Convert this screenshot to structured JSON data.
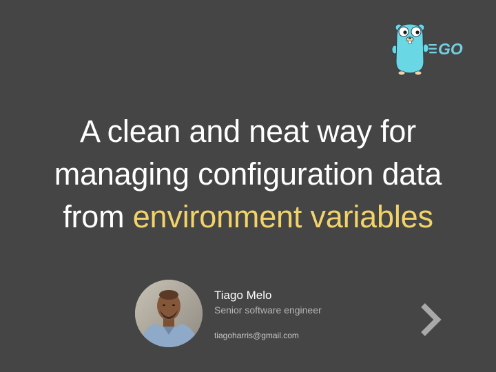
{
  "slide": {
    "title": {
      "line1": "A clean and neat way for",
      "line2": "managing configuration data",
      "line3_prefix": "from ",
      "line3_highlight": "environment variables"
    },
    "logo": {
      "icon": "go-gopher-logo",
      "text": "GO",
      "color": "#73cfe2"
    },
    "author": {
      "name": "Tiago Melo",
      "role": "Senior software engineer",
      "email": "tiagoharris@gmail.com",
      "avatar_icon": "avatar-photo"
    },
    "navigation": {
      "next_icon": "chevron-right-icon"
    }
  },
  "colors": {
    "background": "#454545",
    "title": "#ffffff",
    "highlight": "#f2d36a",
    "role_text": "#b5b5b5",
    "arrow": "#a9a9a9"
  }
}
